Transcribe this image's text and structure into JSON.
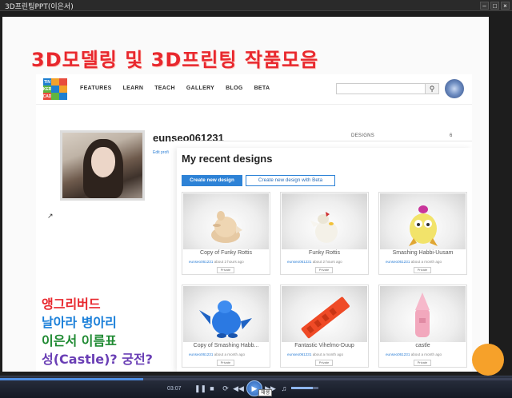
{
  "window": {
    "title": "3D프린팅PPT(이은서)",
    "buttons": [
      "–",
      "□",
      "×"
    ]
  },
  "slide": {
    "title": "3D모델링 및 3D프린팅 작품모음",
    "notes": [
      {
        "text": "앵그리버드",
        "color": "#e8282e"
      },
      {
        "text": "날아라 병아리",
        "color": "#1a7fd9"
      },
      {
        "text": "이은서 이름표",
        "color": "#1f8a32"
      },
      {
        "text": "성(Castle)? 궁전?",
        "color": "#6a3fb5"
      }
    ]
  },
  "site": {
    "logo_cells": [
      {
        "t": "TIN",
        "c": "#1e7fd0"
      },
      {
        "t": "",
        "c": "#f2a12a"
      },
      {
        "t": "",
        "c": "#e84c3d"
      },
      {
        "t": "KER",
        "c": "#5fb540"
      },
      {
        "t": "",
        "c": "#1e7fd0"
      },
      {
        "t": "",
        "c": "#f2a12a"
      },
      {
        "t": "CAD",
        "c": "#e84c3d"
      },
      {
        "t": "",
        "c": "#5fb540"
      },
      {
        "t": "",
        "c": "#1e7fd0"
      }
    ],
    "nav": [
      "FEATURES",
      "LEARN",
      "TEACH",
      "GALLERY",
      "BLOG",
      "BETA"
    ],
    "search_icon": "search-icon",
    "profile": {
      "username": "eunseo061231",
      "edit_link": "Edit profi",
      "designs_label": "DESIGNS",
      "designs_count": "6"
    },
    "recent": {
      "title": "My recent designs",
      "create_button": "Create new design",
      "create_beta_button": "Create new design with Beta"
    },
    "designs": [
      {
        "name": "Copy of Funky Rottis",
        "user": "eunseo061231",
        "time": "about 2 hours ago",
        "tag": "Private"
      },
      {
        "name": "Funky Rottis",
        "user": "eunseo061231",
        "time": "about 2 hours ago",
        "tag": "Private"
      },
      {
        "name": "Smashing Habbi-Uusam",
        "user": "eunseo061231",
        "time": "about a month ago",
        "tag": "Private"
      },
      {
        "name": "Copy of Smashing Habb...",
        "user": "eunseo061231",
        "time": "about a month ago",
        "tag": "Private"
      },
      {
        "name": "Fantastic Vihelmo-Duup",
        "user": "eunseo061231",
        "time": "about a month ago",
        "tag": "Private"
      },
      {
        "name": "castle",
        "user": "eunseo061231",
        "time": "about a month ago",
        "tag": "Private"
      }
    ]
  },
  "player": {
    "time": "03:07",
    "progress": 0.28,
    "volume": 0.8,
    "tooltip": "재생"
  }
}
